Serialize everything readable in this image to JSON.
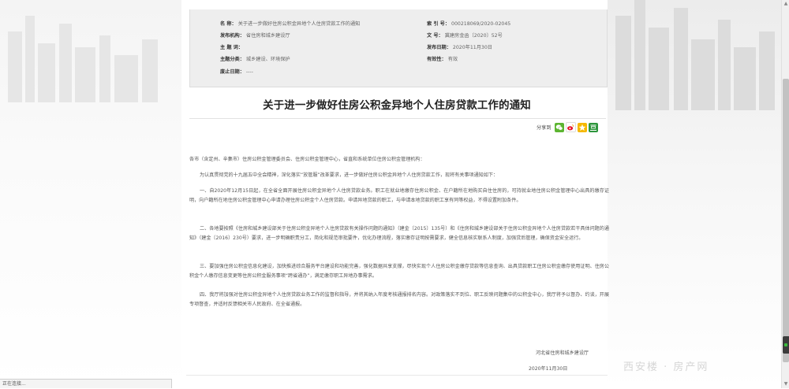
{
  "meta": {
    "name_label": "名 称：",
    "name_value": "关于进一步做好住房公积金异地个人住房贷款工作的通知",
    "index_label": "索 引 号：",
    "index_value": "000218069/2020-02045",
    "issuer_label": "发布机构：",
    "issuer_value": "省住房和城乡建设厅",
    "docno_label": "文 号：",
    "docno_value": "冀建房金函〔2020〕52号",
    "keywords_label": "主 题 词：",
    "keywords_value": "",
    "date_label": "发布日期：",
    "date_value": "2020年11月30日",
    "category_label": "主题分类：",
    "category_value": "城乡建设、环境保护",
    "validity_label": "有效性：",
    "validity_value": "有效",
    "abolish_label": "废止日期：",
    "abolish_value": "----"
  },
  "document": {
    "title": "关于进一步做好住房公积金异地个人住房贷款工作的通知",
    "share_label": "分享到",
    "salutation": "各市（含定州、辛集市）住房公积金管理委员会、住房公积金管理中心，省直和系统单位住房公积金管理机构：",
    "paragraphs": [
      "为认真贯彻党的十九届五中全会精神，深化落实“放管服”改革要求，进一步做好住房公积金异地个人住房贷款工作，现将有关事项通知如下：",
      "一、自2020年12月15日起，在全省全面开展住房公积金异地个人住房贷款业务。职工在就业地缴存住房公积金、在户籍所在地购买自住住房的，可持就业地住房公积金管理中心出具的缴存证明，向户籍所在地住房公积金管理中心申请办理住房公积金个人住房贷款。申请异地贷款的职工，与申请本地贷款的职工享有同等权益，不得设置附加条件。",
      "二、各地要按照《住房和城乡建设部关于住房公积金异地个人住房贷款有关操作问题的通知》（建金〔2015〕135号）和《住房和城乡建设部关于住房公积金异地个人住房贷款若干具体问题的通知》（建金〔2016〕230号）要求，进一步明确职责分工，简化和规范审批要件，优化办理流程，落实缴存证明按需要求，健全信息核实联系人制度，加强贷后管理，确保资金安全运行。",
      "三、要加强住房公积金信息化建设，加快推进综合服务平台建设和功能完善，强化数据共享支撑，尽快实现个人住房公积金缴存贷款等信息查询、出具贷款职工住房公积金缴存使用证明、住房公积金个人缴存信息变更等住房公积金服务事项“跨省通办”，满足缴存职工异地办事需求。",
      "四、我厅将加强对住房公积金异地个人住房贷款业务工作的监督和指导，并将其纳入年度考核通报排名内容。对政策落实不到位、职工反映问题集中的公积金中心，我厅将予以督办、约谈，开展专项督查，并适时反馈相关市人民政府、在全省通报。"
    ],
    "signature": "河北省住房和城乡建设厅",
    "sign_date": "2020年11月30日"
  },
  "status_bar": {
    "text": "正在连接..."
  },
  "watermark": "西安楼 · 房产网",
  "colors": {
    "share_wechat": "#5cb531",
    "share_weibo": "#e6162d",
    "share_qzone": "#f5b800",
    "share_douban": "#2e963d"
  },
  "icons": [
    "wechat-icon",
    "weibo-icon",
    "qzone-icon",
    "douban-icon"
  ]
}
